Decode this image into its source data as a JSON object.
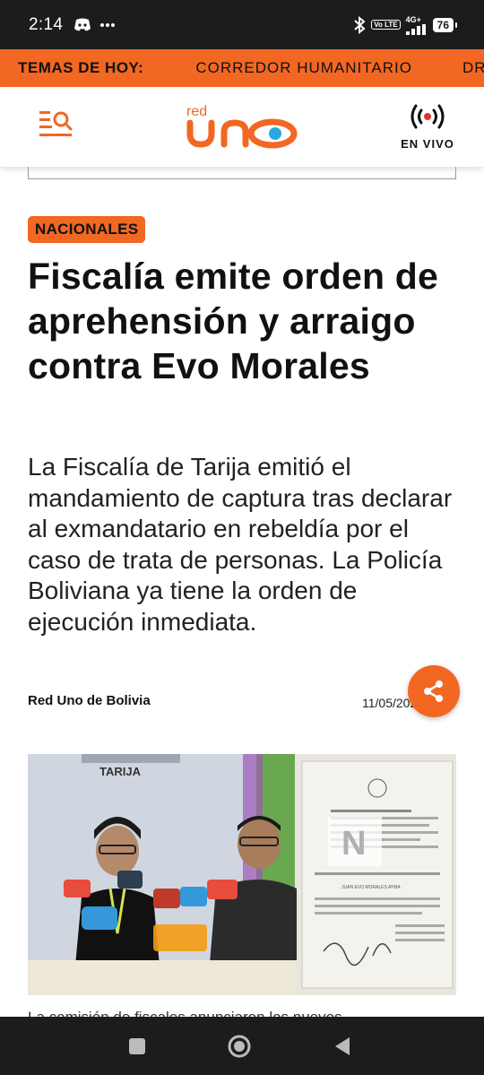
{
  "status_bar": {
    "time": "2:14",
    "network": "4G+",
    "volte": "Vo LTE",
    "battery": "76"
  },
  "topics": {
    "label": "TEMAS DE HOY:",
    "items": [
      "CORREDOR HUMANITARIO",
      "DR"
    ]
  },
  "header": {
    "logo_small": "red",
    "logo_big": "uno",
    "live_label": "EN VIVO"
  },
  "article": {
    "category": "NACIONALES",
    "headline": "Fiscalía emite orden de aprehensión y arraigo contra Evo Morales",
    "summary": "La Fiscalía de Tarija emitió el mandamiento de captura tras declarar al exmandatario en rebeldía por el caso de trata de personas. La Policía Boliviana ya tiene la orden de ejecución inmediata.",
    "author": "Red Uno de Bolivia",
    "date": "11/05/2025",
    "photo_texts": {
      "wall_sign": "TARIJA",
      "doc_name": "JUAN EVO MORALES AYMA",
      "watermark": "N"
    },
    "caption": "La comisión de fiscales anunciaron los nuevos"
  },
  "colors": {
    "accent": "#f26722",
    "status_bg": "#1c1c1e",
    "live_red": "#e63027",
    "logo_blue": "#2aa9e0"
  },
  "icons": [
    "discord-icon",
    "more-dots-icon",
    "bluetooth-icon",
    "signal-icon",
    "menu-search-icon",
    "live-broadcast-icon",
    "share-icon",
    "nav-recents-icon",
    "nav-home-icon",
    "nav-back-icon"
  ]
}
